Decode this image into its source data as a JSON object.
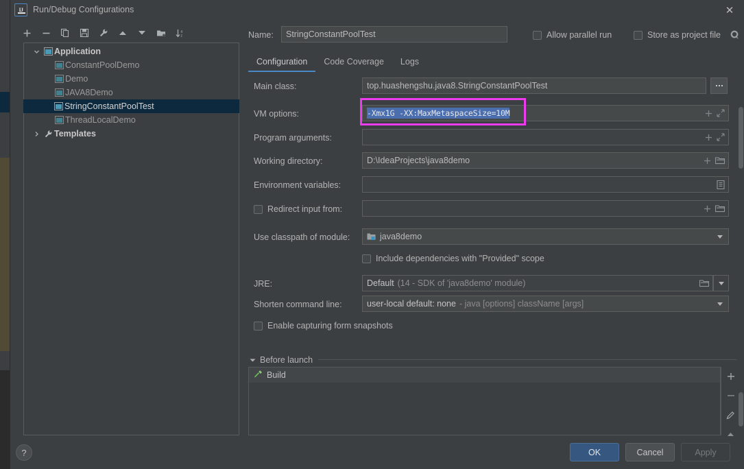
{
  "window": {
    "title": "Run/Debug Configurations",
    "app_icon": "intellij-idea-icon",
    "close_icon": "close-icon"
  },
  "toolbar": {
    "buttons": [
      {
        "name": "add-configuration-button",
        "icon": "plus-icon"
      },
      {
        "name": "remove-configuration-button",
        "icon": "minus-icon"
      },
      {
        "name": "copy-configuration-button",
        "icon": "copy-icon"
      },
      {
        "name": "save-configuration-button",
        "icon": "save-icon"
      },
      {
        "name": "edit-templates-button",
        "icon": "wrench-icon"
      },
      {
        "name": "move-up-button",
        "icon": "arrow-up-icon"
      },
      {
        "name": "move-down-button",
        "icon": "arrow-down-icon"
      },
      {
        "name": "new-folder-button",
        "icon": "folder-plus-icon"
      },
      {
        "name": "sort-configurations-button",
        "icon": "sort-az-icon"
      }
    ]
  },
  "tree": {
    "items": [
      {
        "label": "Application",
        "level": 0,
        "expanded": true,
        "bold": true,
        "icon": "application-icon",
        "selected": false
      },
      {
        "label": "ConstantPoolDemo",
        "level": 1,
        "expanded": null,
        "bold": false,
        "icon": "run-config-icon",
        "selected": false
      },
      {
        "label": "Demo",
        "level": 1,
        "expanded": null,
        "bold": false,
        "icon": "run-config-icon",
        "selected": false
      },
      {
        "label": "JAVA8Demo",
        "level": 1,
        "expanded": null,
        "bold": false,
        "icon": "run-config-icon",
        "selected": false
      },
      {
        "label": "StringConstantPoolTest",
        "level": 1,
        "expanded": null,
        "bold": false,
        "icon": "run-config-icon",
        "selected": true
      },
      {
        "label": "ThreadLocalDemo",
        "level": 1,
        "expanded": null,
        "bold": false,
        "icon": "run-config-icon",
        "selected": false
      },
      {
        "label": "Templates",
        "level": 0,
        "expanded": false,
        "bold": true,
        "icon": "wrench-icon",
        "selected": false
      }
    ]
  },
  "header": {
    "name_label": "Name:",
    "name_value": "StringConstantPoolTest",
    "allow_parallel_run": {
      "label": "Allow parallel run",
      "checked": false
    },
    "store_as_project_file": {
      "label": "Store as project file",
      "checked": false,
      "gear_icon": "gear-icon"
    }
  },
  "tabs": [
    {
      "label": "Configuration",
      "active": true
    },
    {
      "label": "Code Coverage",
      "active": false
    },
    {
      "label": "Logs",
      "active": false
    }
  ],
  "form": {
    "main_class": {
      "label": "Main class:",
      "value": "top.huashengshu.java8.StringConstantPoolTest",
      "browse_icon": "ellipsis-icon"
    },
    "vm_options": {
      "label": "VM options:",
      "value": "-Xmx1G -XX:MaxMetaspaceSize=10M",
      "selected": true,
      "highlight_color": "#ee3bee",
      "selection_color": "#4b6eaf",
      "macro_icon": "plus-icon",
      "expand_icon": "expand-icon"
    },
    "program_arguments": {
      "label": "Program arguments:",
      "value": "",
      "macro_icon": "plus-icon",
      "expand_icon": "expand-icon"
    },
    "working_directory": {
      "label": "Working directory:",
      "value": "D:\\IdeaProjects\\java8demo",
      "macro_icon": "plus-icon",
      "folder_icon": "folder-icon"
    },
    "environment_variables": {
      "label": "Environment variables:",
      "value": "",
      "list_icon": "list-icon"
    },
    "redirect_input": {
      "label": "Redirect input from:",
      "checked": false,
      "value": "",
      "macro_icon": "plus-icon",
      "folder_icon": "folder-icon"
    },
    "classpath_module": {
      "label": "Use classpath of module:",
      "value": "java8demo",
      "module_icon": "module-icon",
      "dropdown_icon": "chevron-down-icon"
    },
    "include_provided": {
      "label": "Include dependencies with \"Provided\" scope",
      "checked": false
    },
    "jre": {
      "label": "JRE:",
      "value": "Default",
      "hint": "(14 - SDK of 'java8demo' module)",
      "folder_icon": "folder-icon",
      "dropdown_icon": "chevron-down-icon"
    },
    "shorten_command_line": {
      "label": "Shorten command line:",
      "value": "user-local default: none",
      "hint": "- java [options] className [args]",
      "dropdown_icon": "chevron-down-icon"
    },
    "form_snapshots": {
      "label": "Enable capturing form snapshots",
      "checked": false
    }
  },
  "before_launch": {
    "title": "Before launch",
    "expanded": true,
    "collapse_icon": "triangle-down-icon",
    "items": [
      {
        "label": "Build",
        "icon": "hammer-icon",
        "icon_color": "#6fba5a"
      }
    ],
    "toolbar": [
      {
        "name": "add-task-button",
        "icon": "plus-icon"
      },
      {
        "name": "remove-task-button",
        "icon": "minus-icon"
      },
      {
        "name": "edit-task-button",
        "icon": "pencil-icon"
      },
      {
        "name": "move-task-up-button",
        "icon": "arrow-up-icon"
      }
    ]
  },
  "footer": {
    "help_label": "?",
    "ok_label": "OK",
    "cancel_label": "Cancel",
    "apply_label": "Apply",
    "apply_disabled": true,
    "ok_color": "#365880"
  }
}
